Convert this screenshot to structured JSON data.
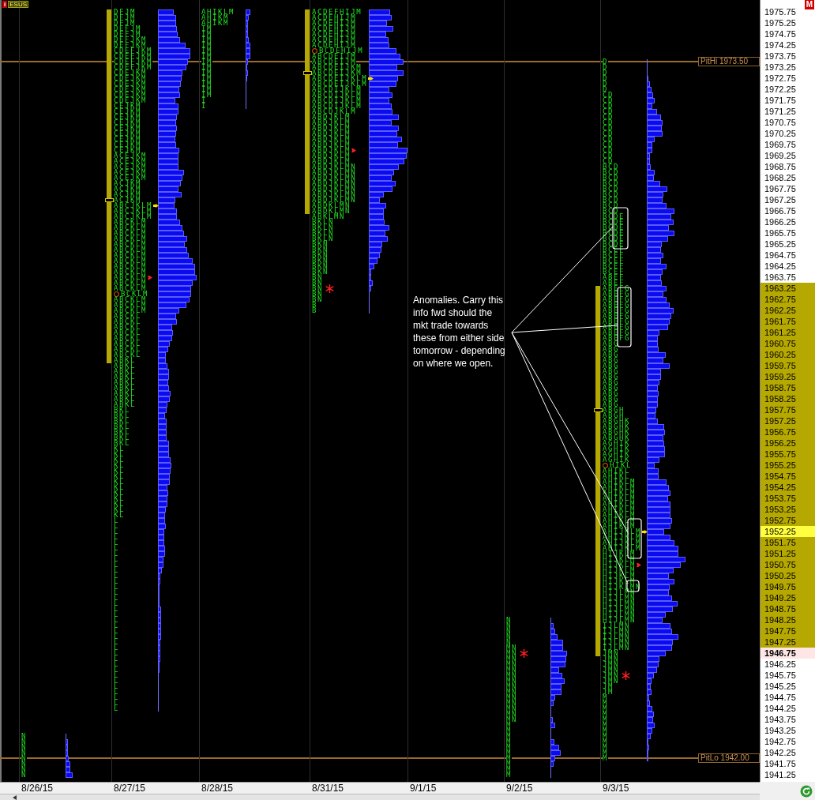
{
  "symbol_tag": {
    "icon_letter": "i",
    "symbol": "ESUS"
  },
  "mode_badge": "M",
  "reference_lines": [
    {
      "label": "PitHi 1973.50"
    },
    {
      "label": "PitLo 1942.00"
    }
  ],
  "annotation": {
    "text": "Anomalies. Carry this info fwd should the mkt trade towards these from either side tomorrow - depending on where we open."
  },
  "days": [
    {
      "date": "8/26/15",
      "profile": {
        "rows": [
          {
            "tpo": "N",
            "kind": "plain"
          },
          {
            "tpo": "N",
            "kind": "plain"
          },
          {
            "tpo": "N",
            "kind": "plain"
          },
          {
            "tpo": "N",
            "kind": "plain"
          },
          {
            "tpo": "N",
            "kind": "plain"
          },
          {
            "tpo": "N",
            "kind": "plain"
          },
          {
            "tpo": "N",
            "kind": "plain"
          },
          {
            "tpo": "N",
            "kind": "plain"
          }
        ]
      }
    },
    {
      "date": "8/27/15",
      "profile": {
        "rows": [
          {
            "tpo": "DFJM",
            "kind": "va_top"
          },
          {
            "tpo": "DFJM",
            "kind": "plain"
          },
          {
            "tpo": "DFJM",
            "kind": "plain"
          },
          {
            "tpo": "DEFJM",
            "kind": "plain"
          },
          {
            "tpo": "DEFJM",
            "kind": "plain"
          },
          {
            "tpo": "DEFJKM",
            "kind": "plain"
          },
          {
            "tpo": "DEFJKM",
            "kind": "plain"
          },
          {
            "tpo": "CDEFJKM",
            "kind": "plain"
          },
          {
            "tpo": "CDEFJKM",
            "kind": "plain"
          },
          {
            "tpo": "CDEFJKM",
            "kind": "plain"
          },
          {
            "tpo": "CDEFJKM",
            "kind": "plain"
          },
          {
            "tpo": "CDEJKM",
            "kind": "plain"
          },
          {
            "tpo": "CDEJKM",
            "kind": "plain"
          },
          {
            "tpo": "CDEJKM",
            "kind": "plain"
          },
          {
            "tpo": "CDEJKM",
            "kind": "plain"
          },
          {
            "tpo": "CDEJKM",
            "kind": "plain"
          },
          {
            "tpo": "CDEJKM",
            "kind": "plain"
          },
          {
            "tpo": "CEJKM",
            "kind": "plain"
          },
          {
            "tpo": "CEJKM",
            "kind": "plain"
          },
          {
            "tpo": "CEJKM",
            "kind": "plain"
          },
          {
            "tpo": "CEJKM",
            "kind": "plain"
          },
          {
            "tpo": "CEJKM",
            "kind": "plain"
          },
          {
            "tpo": "CEJKM",
            "kind": "plain"
          },
          {
            "tpo": "CEJKM",
            "kind": "plain"
          },
          {
            "tpo": "CEJKM",
            "kind": "plain"
          },
          {
            "tpo": "CEJKM",
            "kind": "plain"
          },
          {
            "tpo": "ACEJKM",
            "kind": "plain"
          },
          {
            "tpo": "ACEJKM",
            "kind": "plain"
          },
          {
            "tpo": "ACEJKM",
            "kind": "plain"
          },
          {
            "tpo": "ACEJKM",
            "kind": "plain"
          },
          {
            "tpo": "ACEJKM",
            "kind": "plain"
          },
          {
            "tpo": "ACJKM",
            "kind": "plain"
          },
          {
            "tpo": "ACJKM",
            "kind": "plain"
          },
          {
            "tpo": "ACJKM",
            "kind": "plain"
          },
          {
            "tpo": "ACJKM",
            "kind": "poc"
          },
          {
            "tpo": "ABCJKLM",
            "kind": "arrow"
          },
          {
            "tpo": "ABCJKLM",
            "kind": "plain"
          },
          {
            "tpo": "ABCJKLM",
            "kind": "plain"
          },
          {
            "tpo": "ABCKLM",
            "kind": "plain"
          },
          {
            "tpo": "ABCKLM",
            "kind": "plain"
          },
          {
            "tpo": "ABCKLM",
            "kind": "plain"
          },
          {
            "tpo": "ABCKLM",
            "kind": "plain"
          },
          {
            "tpo": "ABCKLM",
            "kind": "plain"
          },
          {
            "tpo": "ABCKLM",
            "kind": "plain"
          },
          {
            "tpo": "ABCKLM",
            "kind": "plain"
          },
          {
            "tpo": "ABCKLM",
            "kind": "plain"
          },
          {
            "tpo": "ABCKLM",
            "kind": "plain"
          },
          {
            "tpo": "ABCKLM",
            "kind": "plain"
          },
          {
            "tpo": "ABCKLM",
            "kind": "tick"
          },
          {
            "tpo": "ABCKLM",
            "kind": "plain"
          },
          {
            "tpo": "ABCKLM",
            "kind": "plain"
          },
          {
            "tpo": "BCKLM",
            "kind": "circle"
          },
          {
            "tpo": "ABCKLM",
            "kind": "plain"
          },
          {
            "tpo": "ABCKLM",
            "kind": "plain"
          },
          {
            "tpo": "ABCKLM",
            "kind": "plain"
          },
          {
            "tpo": "ABCKL",
            "kind": "plain"
          },
          {
            "tpo": "ABCKL",
            "kind": "plain"
          },
          {
            "tpo": "ABCKL",
            "kind": "plain"
          },
          {
            "tpo": "ABCKL",
            "kind": "plain"
          },
          {
            "tpo": "ABCKL",
            "kind": "plain"
          },
          {
            "tpo": "ABCKL",
            "kind": "plain"
          },
          {
            "tpo": "ABCKL",
            "kind": "plain"
          },
          {
            "tpo": "ABCKL",
            "kind": "plain"
          },
          {
            "tpo": "ABKL",
            "kind": "va_bottom"
          },
          {
            "tpo": "ABKL",
            "kind": "plain"
          },
          {
            "tpo": "ABKL",
            "kind": "plain"
          },
          {
            "tpo": "ABKL",
            "kind": "plain"
          },
          {
            "tpo": "ABKL",
            "kind": "plain"
          },
          {
            "tpo": "ABKL",
            "kind": "plain"
          },
          {
            "tpo": "ABKL",
            "kind": "plain"
          },
          {
            "tpo": "ABKL",
            "kind": "plain"
          },
          {
            "tpo": "ABKL",
            "kind": "plain"
          },
          {
            "tpo": "BKL",
            "kind": "plain"
          },
          {
            "tpo": "BKL",
            "kind": "plain"
          },
          {
            "tpo": "BKL",
            "kind": "plain"
          },
          {
            "tpo": "BKL",
            "kind": "plain"
          },
          {
            "tpo": "BKL",
            "kind": "plain"
          },
          {
            "tpo": "BKL",
            "kind": "plain"
          },
          {
            "tpo": "BKL",
            "kind": "plain"
          },
          {
            "tpo": "KL",
            "kind": "plain"
          },
          {
            "tpo": "KL",
            "kind": "plain"
          },
          {
            "tpo": "KL",
            "kind": "plain"
          },
          {
            "tpo": "KL",
            "kind": "plain"
          },
          {
            "tpo": "KL",
            "kind": "plain"
          },
          {
            "tpo": "KL",
            "kind": "plain"
          },
          {
            "tpo": "KL",
            "kind": "plain"
          },
          {
            "tpo": "KL",
            "kind": "plain"
          },
          {
            "tpo": "KL",
            "kind": "plain"
          },
          {
            "tpo": "KL",
            "kind": "plain"
          },
          {
            "tpo": "KL",
            "kind": "plain"
          },
          {
            "tpo": "KL",
            "kind": "plain"
          },
          {
            "tpo": "KL",
            "kind": "plain"
          },
          {
            "tpo": "L",
            "kind": "plain"
          },
          {
            "tpo": "L",
            "kind": "plain"
          },
          {
            "tpo": "L",
            "kind": "plain"
          },
          {
            "tpo": "L",
            "kind": "plain"
          },
          {
            "tpo": "L",
            "kind": "plain"
          },
          {
            "tpo": "L",
            "kind": "plain"
          },
          {
            "tpo": "L",
            "kind": "plain"
          },
          {
            "tpo": "L",
            "kind": "plain"
          },
          {
            "tpo": "L",
            "kind": "plain"
          },
          {
            "tpo": "L",
            "kind": "plain"
          },
          {
            "tpo": "L",
            "kind": "plain"
          },
          {
            "tpo": "L",
            "kind": "plain"
          },
          {
            "tpo": "L",
            "kind": "plain"
          },
          {
            "tpo": "L",
            "kind": "plain"
          },
          {
            "tpo": "L",
            "kind": "plain"
          },
          {
            "tpo": "L",
            "kind": "plain"
          },
          {
            "tpo": "L",
            "kind": "plain"
          },
          {
            "tpo": "L",
            "kind": "plain"
          },
          {
            "tpo": "L",
            "kind": "plain"
          },
          {
            "tpo": "L",
            "kind": "plain"
          },
          {
            "tpo": "L",
            "kind": "plain"
          },
          {
            "tpo": "L",
            "kind": "plain"
          },
          {
            "tpo": "L",
            "kind": "plain"
          },
          {
            "tpo": "L",
            "kind": "plain"
          },
          {
            "tpo": "L",
            "kind": "plain"
          },
          {
            "tpo": "L",
            "kind": "plain"
          },
          {
            "tpo": "L",
            "kind": "plain"
          },
          {
            "tpo": "L",
            "kind": "plain"
          },
          {
            "tpo": "L",
            "kind": "plain"
          },
          {
            "tpo": "L",
            "kind": "plain"
          },
          {
            "tpo": "L",
            "kind": "plain"
          },
          {
            "tpo": "L",
            "kind": "plain"
          },
          {
            "tpo": "L",
            "kind": "plain"
          },
          {
            "tpo": "L",
            "kind": "plain"
          },
          {
            "tpo": "L",
            "kind": "plain"
          }
        ]
      }
    },
    {
      "date": "8/28/15",
      "profile": {
        "rows": [
          {
            "tpo": "AHIKLM",
            "kind": "plain"
          },
          {
            "tpo": "AHIKM",
            "kind": "plain"
          },
          {
            "tpo": "AHIKM",
            "kind": "plain"
          },
          {
            "tpo": "IM",
            "kind": "plain"
          },
          {
            "tpo": "IM",
            "kind": "plain"
          },
          {
            "tpo": "IM",
            "kind": "plain"
          },
          {
            "tpo": "IM",
            "kind": "plain"
          },
          {
            "tpo": "IM",
            "kind": "plain"
          },
          {
            "tpo": "IM",
            "kind": "plain"
          },
          {
            "tpo": "IM",
            "kind": "plain"
          },
          {
            "tpo": "IM",
            "kind": "plain"
          },
          {
            "tpo": "IM",
            "kind": "plain"
          },
          {
            "tpo": "IM",
            "kind": "plain"
          },
          {
            "tpo": "IM",
            "kind": "plain"
          },
          {
            "tpo": "IM",
            "kind": "plain"
          },
          {
            "tpo": "IM",
            "kind": "plain"
          },
          {
            "tpo": "I",
            "kind": "plain"
          },
          {
            "tpo": "I",
            "kind": "plain"
          }
        ]
      }
    },
    {
      "date": "8/31/15",
      "profile": {
        "rows": [
          {
            "tpo": "ACDEFHIJM",
            "kind": "va_top"
          },
          {
            "tpo": "ACDEHIJM",
            "kind": "plain"
          },
          {
            "tpo": "ACDEHIJM",
            "kind": "plain"
          },
          {
            "tpo": "ACDEHIJM",
            "kind": "plain"
          },
          {
            "tpo": "ACDEHIJM",
            "kind": "plain"
          },
          {
            "tpo": "ACDEHIJM",
            "kind": "plain"
          },
          {
            "tpo": "ACDEHIJM",
            "kind": "plain"
          },
          {
            "tpo": "BCDEHIJM",
            "kind": "circle"
          },
          {
            "tpo": "ABCDEIJM",
            "kind": "plain"
          },
          {
            "tpo": "ABCDEIJM",
            "kind": "plain"
          },
          {
            "tpo": "ABCDEIJKM",
            "kind": "plain"
          },
          {
            "tpo": "ABCDEIJKM",
            "kind": "poc"
          },
          {
            "tpo": "ABCDEIJKLM",
            "kind": "arrow"
          },
          {
            "tpo": "ABCDEIJKLM",
            "kind": "plain"
          },
          {
            "tpo": "ABCDIJKLM",
            "kind": "plain"
          },
          {
            "tpo": "ABCDIJKLM",
            "kind": "plain"
          },
          {
            "tpo": "ABCDIJKLM",
            "kind": "plain"
          },
          {
            "tpo": "ABCDIJKLM",
            "kind": "plain"
          },
          {
            "tpo": "ABCDJKLM",
            "kind": "plain"
          },
          {
            "tpo": "ABDJKLM",
            "kind": "plain"
          },
          {
            "tpo": "ABDJKLM",
            "kind": "plain"
          },
          {
            "tpo": "ABDJKLM",
            "kind": "plain"
          },
          {
            "tpo": "ABDJKLM",
            "kind": "plain"
          },
          {
            "tpo": "ABDJKLM",
            "kind": "plain"
          },
          {
            "tpo": "ABDJKLM",
            "kind": "plain"
          },
          {
            "tpo": "ABDJKLM",
            "kind": "tick"
          },
          {
            "tpo": "ABDJKLM",
            "kind": "plain"
          },
          {
            "tpo": "ABDJKLM",
            "kind": "plain"
          },
          {
            "tpo": "ABDJKLMN",
            "kind": "plain"
          },
          {
            "tpo": "ABDJKLMN",
            "kind": "plain"
          },
          {
            "tpo": "ABDJKLMN",
            "kind": "plain"
          },
          {
            "tpo": "ABDJKLMN",
            "kind": "plain"
          },
          {
            "tpo": "ABDJKLMN",
            "kind": "plain"
          },
          {
            "tpo": "ABDJKLMN",
            "kind": "plain"
          },
          {
            "tpo": "ABDJKLMN",
            "kind": "plain"
          },
          {
            "tpo": "ABDKLMN",
            "kind": "plain"
          },
          {
            "tpo": "ABDKLMN",
            "kind": "va_bottom"
          },
          {
            "tpo": "ABKLMN",
            "kind": "plain"
          },
          {
            "tpo": "BKLN",
            "kind": "plain"
          },
          {
            "tpo": "BKLN",
            "kind": "plain"
          },
          {
            "tpo": "BKLN",
            "kind": "plain"
          },
          {
            "tpo": "BKLN",
            "kind": "plain"
          },
          {
            "tpo": "BKN",
            "kind": "plain"
          },
          {
            "tpo": "BKN",
            "kind": "plain"
          },
          {
            "tpo": "BKN",
            "kind": "plain"
          },
          {
            "tpo": "BKN",
            "kind": "plain"
          },
          {
            "tpo": "BKN",
            "kind": "plain"
          },
          {
            "tpo": "BKN",
            "kind": "plain"
          },
          {
            "tpo": "BN",
            "kind": "plain"
          },
          {
            "tpo": "BN",
            "kind": "plain"
          },
          {
            "tpo": "BN",
            "kind": "star"
          },
          {
            "tpo": "BN",
            "kind": "plain"
          },
          {
            "tpo": "BN",
            "kind": "plain"
          },
          {
            "tpo": "B",
            "kind": "plain"
          },
          {
            "tpo": "B",
            "kind": "plain"
          }
        ]
      }
    },
    {
      "date": "9/1/15"
    },
    {
      "date": "9/2/15",
      "profile": {
        "rows": [
          {
            "tpo": "N",
            "kind": "plain"
          },
          {
            "tpo": "N",
            "kind": "plain"
          },
          {
            "tpo": "N",
            "kind": "plain"
          },
          {
            "tpo": "N",
            "kind": "plain"
          },
          {
            "tpo": "N",
            "kind": "plain"
          },
          {
            "tpo": "MN",
            "kind": "plain"
          },
          {
            "tpo": "MN",
            "kind": "star"
          },
          {
            "tpo": "MN",
            "kind": "plain"
          },
          {
            "tpo": "MN",
            "kind": "plain"
          },
          {
            "tpo": "MN",
            "kind": "plain"
          },
          {
            "tpo": "MN",
            "kind": "plain"
          },
          {
            "tpo": "MN",
            "kind": "plain"
          },
          {
            "tpo": "MN",
            "kind": "plain"
          },
          {
            "tpo": "MN",
            "kind": "plain"
          },
          {
            "tpo": "MN",
            "kind": "plain"
          },
          {
            "tpo": "MN",
            "kind": "plain"
          },
          {
            "tpo": "MN",
            "kind": "plain"
          },
          {
            "tpo": "MN",
            "kind": "plain"
          },
          {
            "tpo": "MN",
            "kind": "plain"
          },
          {
            "tpo": "M",
            "kind": "plain"
          },
          {
            "tpo": "M",
            "kind": "plain"
          },
          {
            "tpo": "M",
            "kind": "plain"
          },
          {
            "tpo": "M",
            "kind": "plain"
          },
          {
            "tpo": "M",
            "kind": "plain"
          },
          {
            "tpo": "M",
            "kind": "plain"
          },
          {
            "tpo": "M",
            "kind": "plain"
          },
          {
            "tpo": "M",
            "kind": "plain"
          },
          {
            "tpo": "M",
            "kind": "plain"
          },
          {
            "tpo": "M",
            "kind": "plain"
          }
        ]
      }
    },
    {
      "date": "9/3/15",
      "profile": {
        "rows": [
          {
            "tpo": "D",
            "kind": "plain"
          },
          {
            "tpo": "D",
            "kind": "plain"
          },
          {
            "tpo": "D",
            "kind": "plain"
          },
          {
            "tpo": "D",
            "kind": "plain"
          },
          {
            "tpo": "D",
            "kind": "plain"
          },
          {
            "tpo": "D",
            "kind": "plain"
          },
          {
            "tpo": "CD",
            "kind": "plain"
          },
          {
            "tpo": "CD",
            "kind": "plain"
          },
          {
            "tpo": "CD",
            "kind": "plain"
          },
          {
            "tpo": "CD",
            "kind": "plain"
          },
          {
            "tpo": "CD",
            "kind": "plain"
          },
          {
            "tpo": "CD",
            "kind": "plain"
          },
          {
            "tpo": "CD",
            "kind": "plain"
          },
          {
            "tpo": "CD",
            "kind": "plain"
          },
          {
            "tpo": "CD",
            "kind": "plain"
          },
          {
            "tpo": "CD",
            "kind": "plain"
          },
          {
            "tpo": "CD",
            "kind": "plain"
          },
          {
            "tpo": "CD",
            "kind": "plain"
          },
          {
            "tpo": "CD",
            "kind": "plain"
          },
          {
            "tpo": "BCD",
            "kind": "plain"
          },
          {
            "tpo": "BCD",
            "kind": "plain"
          },
          {
            "tpo": "BCD",
            "kind": "plain"
          },
          {
            "tpo": "BCD",
            "kind": "plain"
          },
          {
            "tpo": "BCD",
            "kind": "plain"
          },
          {
            "tpo": "BCD",
            "kind": "plain"
          },
          {
            "tpo": "BCD",
            "kind": "plain"
          },
          {
            "tpo": "BCD",
            "kind": "plain"
          },
          {
            "tpo": "BCD",
            "kind": "plain"
          },
          {
            "tpo": "BCDE",
            "kind": "plain"
          },
          {
            "tpo": "BCDE",
            "kind": "plain"
          },
          {
            "tpo": "BCDE",
            "kind": "plain"
          },
          {
            "tpo": "BCDE",
            "kind": "plain"
          },
          {
            "tpo": "BCDE",
            "kind": "plain"
          },
          {
            "tpo": "BCDE",
            "kind": "plain"
          },
          {
            "tpo": "BCEF",
            "kind": "plain"
          },
          {
            "tpo": "BCEF",
            "kind": "plain"
          },
          {
            "tpo": "BCEF",
            "kind": "plain"
          },
          {
            "tpo": "BCEF",
            "kind": "plain"
          },
          {
            "tpo": "BCEF",
            "kind": "plain"
          },
          {
            "tpo": "ABEF",
            "kind": "plain"
          },
          {
            "tpo": "ABEF",
            "kind": "plain"
          },
          {
            "tpo": "ABEFG",
            "kind": "va_top"
          },
          {
            "tpo": "ABEFG",
            "kind": "plain"
          },
          {
            "tpo": "ABEFG",
            "kind": "plain"
          },
          {
            "tpo": "ABEFG",
            "kind": "plain"
          },
          {
            "tpo": "ABEFG",
            "kind": "plain"
          },
          {
            "tpo": "ABEFG",
            "kind": "plain"
          },
          {
            "tpo": "ABEFG",
            "kind": "plain"
          },
          {
            "tpo": "ABEFG",
            "kind": "plain"
          },
          {
            "tpo": "ABEFG",
            "kind": "plain"
          },
          {
            "tpo": "ABEFG",
            "kind": "plain"
          },
          {
            "tpo": "ABG",
            "kind": "plain"
          },
          {
            "tpo": "ABG",
            "kind": "plain"
          },
          {
            "tpo": "ABG",
            "kind": "plain"
          },
          {
            "tpo": "ABG",
            "kind": "plain"
          },
          {
            "tpo": "ABG",
            "kind": "plain"
          },
          {
            "tpo": "ABG",
            "kind": "plain"
          },
          {
            "tpo": "ABG",
            "kind": "plain"
          },
          {
            "tpo": "ABG",
            "kind": "plain"
          },
          {
            "tpo": "ABG",
            "kind": "plain"
          },
          {
            "tpo": "ABG",
            "kind": "plain"
          },
          {
            "tpo": "ABG",
            "kind": "plain"
          },
          {
            "tpo": "ABG",
            "kind": "plain"
          },
          {
            "tpo": "ABGH",
            "kind": "poc"
          },
          {
            "tpo": "ABGH",
            "kind": "plain"
          },
          {
            "tpo": "ABGHK",
            "kind": "plain"
          },
          {
            "tpo": "ABGHK",
            "kind": "plain"
          },
          {
            "tpo": "ABGHK",
            "kind": "plain"
          },
          {
            "tpo": "ABGHK",
            "kind": "plain"
          },
          {
            "tpo": "AGHIK",
            "kind": "plain"
          },
          {
            "tpo": "AGHIK",
            "kind": "plain"
          },
          {
            "tpo": "AGHIK",
            "kind": "plain"
          },
          {
            "tpo": "AGHIK",
            "kind": "plain"
          },
          {
            "tpo": "HIKL",
            "kind": "circle"
          },
          {
            "tpo": "AHIKL",
            "kind": "plain"
          },
          {
            "tpo": "AHIKL",
            "kind": "plain"
          },
          {
            "tpo": "AHIKLM",
            "kind": "plain"
          },
          {
            "tpo": "AHIKLM",
            "kind": "plain"
          },
          {
            "tpo": "AHIKLM",
            "kind": "plain"
          },
          {
            "tpo": "AHIKLM",
            "kind": "plain"
          },
          {
            "tpo": "AHIKLM",
            "kind": "plain"
          },
          {
            "tpo": "AHIKLM",
            "kind": "plain"
          },
          {
            "tpo": "AHIKLM",
            "kind": "plain"
          },
          {
            "tpo": "AHIKLM",
            "kind": "plain"
          },
          {
            "tpo": "AHIKLM",
            "kind": "plain"
          },
          {
            "tpo": "AHIJKLM",
            "kind": "arrow"
          },
          {
            "tpo": "AHIJKLM",
            "kind": "plain"
          },
          {
            "tpo": "AHIJKLM",
            "kind": "plain"
          },
          {
            "tpo": "AHIJKLM",
            "kind": "plain"
          },
          {
            "tpo": "HIJKLM",
            "kind": "plain"
          },
          {
            "tpo": "HIJKLM",
            "kind": "plain"
          },
          {
            "tpo": "HIJKLM",
            "kind": "tick"
          },
          {
            "tpo": "HIJKLM",
            "kind": "plain"
          },
          {
            "tpo": "HIJKLM",
            "kind": "plain"
          },
          {
            "tpo": "HIJKLM",
            "kind": "plain"
          },
          {
            "tpo": "HIJKLMN",
            "kind": "plain"
          },
          {
            "tpo": "HIJLMN",
            "kind": "plain"
          },
          {
            "tpo": "HIJLMN",
            "kind": "plain"
          },
          {
            "tpo": "HIJLMN",
            "kind": "plain"
          },
          {
            "tpo": "HIJLMN",
            "kind": "plain"
          },
          {
            "tpo": "HIJLMN",
            "kind": "plain"
          },
          {
            "tpo": "HIJLMN",
            "kind": "plain"
          },
          {
            "tpo": "IJLMN",
            "kind": "plain"
          },
          {
            "tpo": "IJLMN",
            "kind": "plain"
          },
          {
            "tpo": "IJLMN",
            "kind": "plain"
          },
          {
            "tpo": "IJLMN",
            "kind": "plain"
          },
          {
            "tpo": "IJLMN",
            "kind": "plain"
          },
          {
            "tpo": "JMN",
            "kind": "va_bottom"
          },
          {
            "tpo": "JMN",
            "kind": "plain"
          },
          {
            "tpo": "JMN",
            "kind": "plain"
          },
          {
            "tpo": "JMN",
            "kind": "plain"
          },
          {
            "tpo": "JMN",
            "kind": "star"
          },
          {
            "tpo": "JMN",
            "kind": "plain"
          },
          {
            "tpo": "JM",
            "kind": "plain"
          },
          {
            "tpo": "JM",
            "kind": "plain"
          },
          {
            "tpo": "M",
            "kind": "plain"
          },
          {
            "tpo": "M",
            "kind": "plain"
          },
          {
            "tpo": "M",
            "kind": "plain"
          },
          {
            "tpo": "M",
            "kind": "plain"
          },
          {
            "tpo": "M",
            "kind": "plain"
          },
          {
            "tpo": "M",
            "kind": "plain"
          },
          {
            "tpo": "M",
            "kind": "plain"
          },
          {
            "tpo": "M",
            "kind": "plain"
          },
          {
            "tpo": "M",
            "kind": "plain"
          },
          {
            "tpo": "M",
            "kind": "plain"
          },
          {
            "tpo": "M",
            "kind": "plain"
          },
          {
            "tpo": "M",
            "kind": "plain"
          }
        ]
      }
    }
  ],
  "price_axis": {
    "labels": [
      {
        "text": "1975.75",
        "kind": "plain"
      },
      {
        "text": "1975.25",
        "kind": "plain"
      },
      {
        "text": "1974.75",
        "kind": "plain"
      },
      {
        "text": "1974.25",
        "kind": "plain"
      },
      {
        "text": "1973.75",
        "kind": "plain"
      },
      {
        "text": "1973.25",
        "kind": "plain"
      },
      {
        "text": "1972.75",
        "kind": "plain"
      },
      {
        "text": "1972.25",
        "kind": "plain"
      },
      {
        "text": "1971.75",
        "kind": "plain"
      },
      {
        "text": "1971.25",
        "kind": "plain"
      },
      {
        "text": "1970.75",
        "kind": "plain"
      },
      {
        "text": "1970.25",
        "kind": "plain"
      },
      {
        "text": "1969.75",
        "kind": "plain"
      },
      {
        "text": "1969.25",
        "kind": "plain"
      },
      {
        "text": "1968.75",
        "kind": "plain"
      },
      {
        "text": "1968.25",
        "kind": "plain"
      },
      {
        "text": "1967.75",
        "kind": "plain"
      },
      {
        "text": "1967.25",
        "kind": "plain"
      },
      {
        "text": "1966.75",
        "kind": "plain"
      },
      {
        "text": "1966.25",
        "kind": "plain"
      },
      {
        "text": "1965.75",
        "kind": "plain"
      },
      {
        "text": "1965.25",
        "kind": "plain"
      },
      {
        "text": "1964.75",
        "kind": "plain"
      },
      {
        "text": "1964.25",
        "kind": "plain"
      },
      {
        "text": "1963.75",
        "kind": "plain"
      },
      {
        "text": "1963.25",
        "kind": "band"
      },
      {
        "text": "1962.75",
        "kind": "band"
      },
      {
        "text": "1962.25",
        "kind": "band"
      },
      {
        "text": "1961.75",
        "kind": "band"
      },
      {
        "text": "1961.25",
        "kind": "band"
      },
      {
        "text": "1960.75",
        "kind": "band"
      },
      {
        "text": "1960.25",
        "kind": "band"
      },
      {
        "text": "1959.75",
        "kind": "band"
      },
      {
        "text": "1959.25",
        "kind": "band"
      },
      {
        "text": "1958.75",
        "kind": "band"
      },
      {
        "text": "1958.25",
        "kind": "band"
      },
      {
        "text": "1957.75",
        "kind": "band"
      },
      {
        "text": "1957.25",
        "kind": "band"
      },
      {
        "text": "1956.75",
        "kind": "band"
      },
      {
        "text": "1956.25",
        "kind": "band"
      },
      {
        "text": "1955.75",
        "kind": "band"
      },
      {
        "text": "1955.25",
        "kind": "band"
      },
      {
        "text": "1954.75",
        "kind": "band"
      },
      {
        "text": "1954.25",
        "kind": "band"
      },
      {
        "text": "1953.75",
        "kind": "band"
      },
      {
        "text": "1953.25",
        "kind": "band"
      },
      {
        "text": "1952.75",
        "kind": "band"
      },
      {
        "text": "1952.25",
        "kind": "last"
      },
      {
        "text": "1951.75",
        "kind": "band"
      },
      {
        "text": "1951.25",
        "kind": "band"
      },
      {
        "text": "1950.75",
        "kind": "band"
      },
      {
        "text": "1950.25",
        "kind": "band"
      },
      {
        "text": "1949.75",
        "kind": "band"
      },
      {
        "text": "1949.25",
        "kind": "band"
      },
      {
        "text": "1948.75",
        "kind": "band"
      },
      {
        "text": "1948.25",
        "kind": "band"
      },
      {
        "text": "1947.75",
        "kind": "band"
      },
      {
        "text": "1947.25",
        "kind": "band"
      },
      {
        "text": "1946.75",
        "kind": "low"
      },
      {
        "text": "1946.25",
        "kind": "plain"
      },
      {
        "text": "1945.75",
        "kind": "plain"
      },
      {
        "text": "1945.25",
        "kind": "plain"
      },
      {
        "text": "1944.75",
        "kind": "plain"
      },
      {
        "text": "1944.25",
        "kind": "plain"
      },
      {
        "text": "1943.75",
        "kind": "plain"
      },
      {
        "text": "1943.25",
        "kind": "plain"
      },
      {
        "text": "1942.75",
        "kind": "plain"
      },
      {
        "text": "1942.25",
        "kind": "plain"
      },
      {
        "text": "1941.75",
        "kind": "plain"
      },
      {
        "text": "1941.25",
        "kind": "plain"
      }
    ]
  }
}
